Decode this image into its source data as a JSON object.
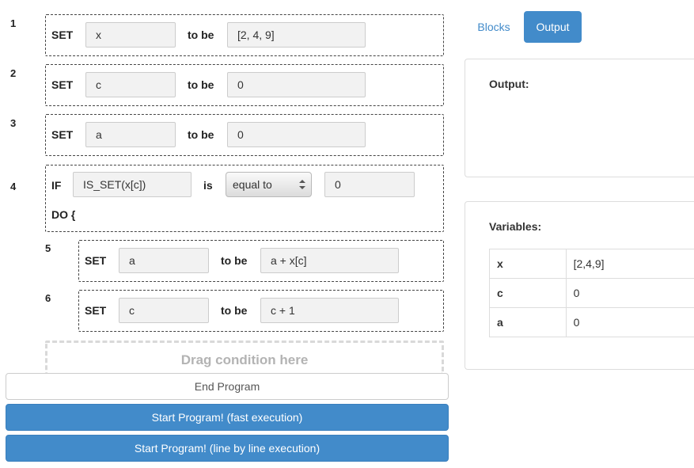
{
  "program": {
    "lines": [
      {
        "num": "1",
        "keyword": "SET",
        "var": "x",
        "to_be": "to be",
        "value": "[2, 4, 9]"
      },
      {
        "num": "2",
        "keyword": "SET",
        "var": "c",
        "to_be": "to be",
        "value": "0"
      },
      {
        "num": "3",
        "keyword": "SET",
        "var": "a",
        "to_be": "to be",
        "value": "0"
      },
      {
        "num": "4",
        "keyword": "IF",
        "condition": "IS_SET(x[c])",
        "is": "is",
        "operator": "equal to",
        "compare": "0",
        "do": "DO {"
      },
      {
        "num": "5",
        "keyword": "SET",
        "var": "a",
        "to_be": "to be",
        "value": "a + x[c]"
      },
      {
        "num": "6",
        "keyword": "SET",
        "var": "c",
        "to_be": "to be",
        "value": "c + 1"
      }
    ],
    "dropzone_label": "Drag condition here"
  },
  "buttons": {
    "end": "End Program",
    "fast": "Start Program! (fast execution)",
    "line_by_line": "Start Program! (line by line execution)"
  },
  "tabs": {
    "blocks": "Blocks",
    "output": "Output",
    "active": "Output"
  },
  "output_panel": {
    "title": "Output:",
    "content": ""
  },
  "variables_panel": {
    "title": "Variables:",
    "rows": [
      {
        "name": "x",
        "value": "[2,4,9]"
      },
      {
        "name": "c",
        "value": "0"
      },
      {
        "name": "a",
        "value": "0"
      }
    ]
  },
  "colors": {
    "accent": "#428bca",
    "dropzone_text": "#b3b3b3"
  }
}
